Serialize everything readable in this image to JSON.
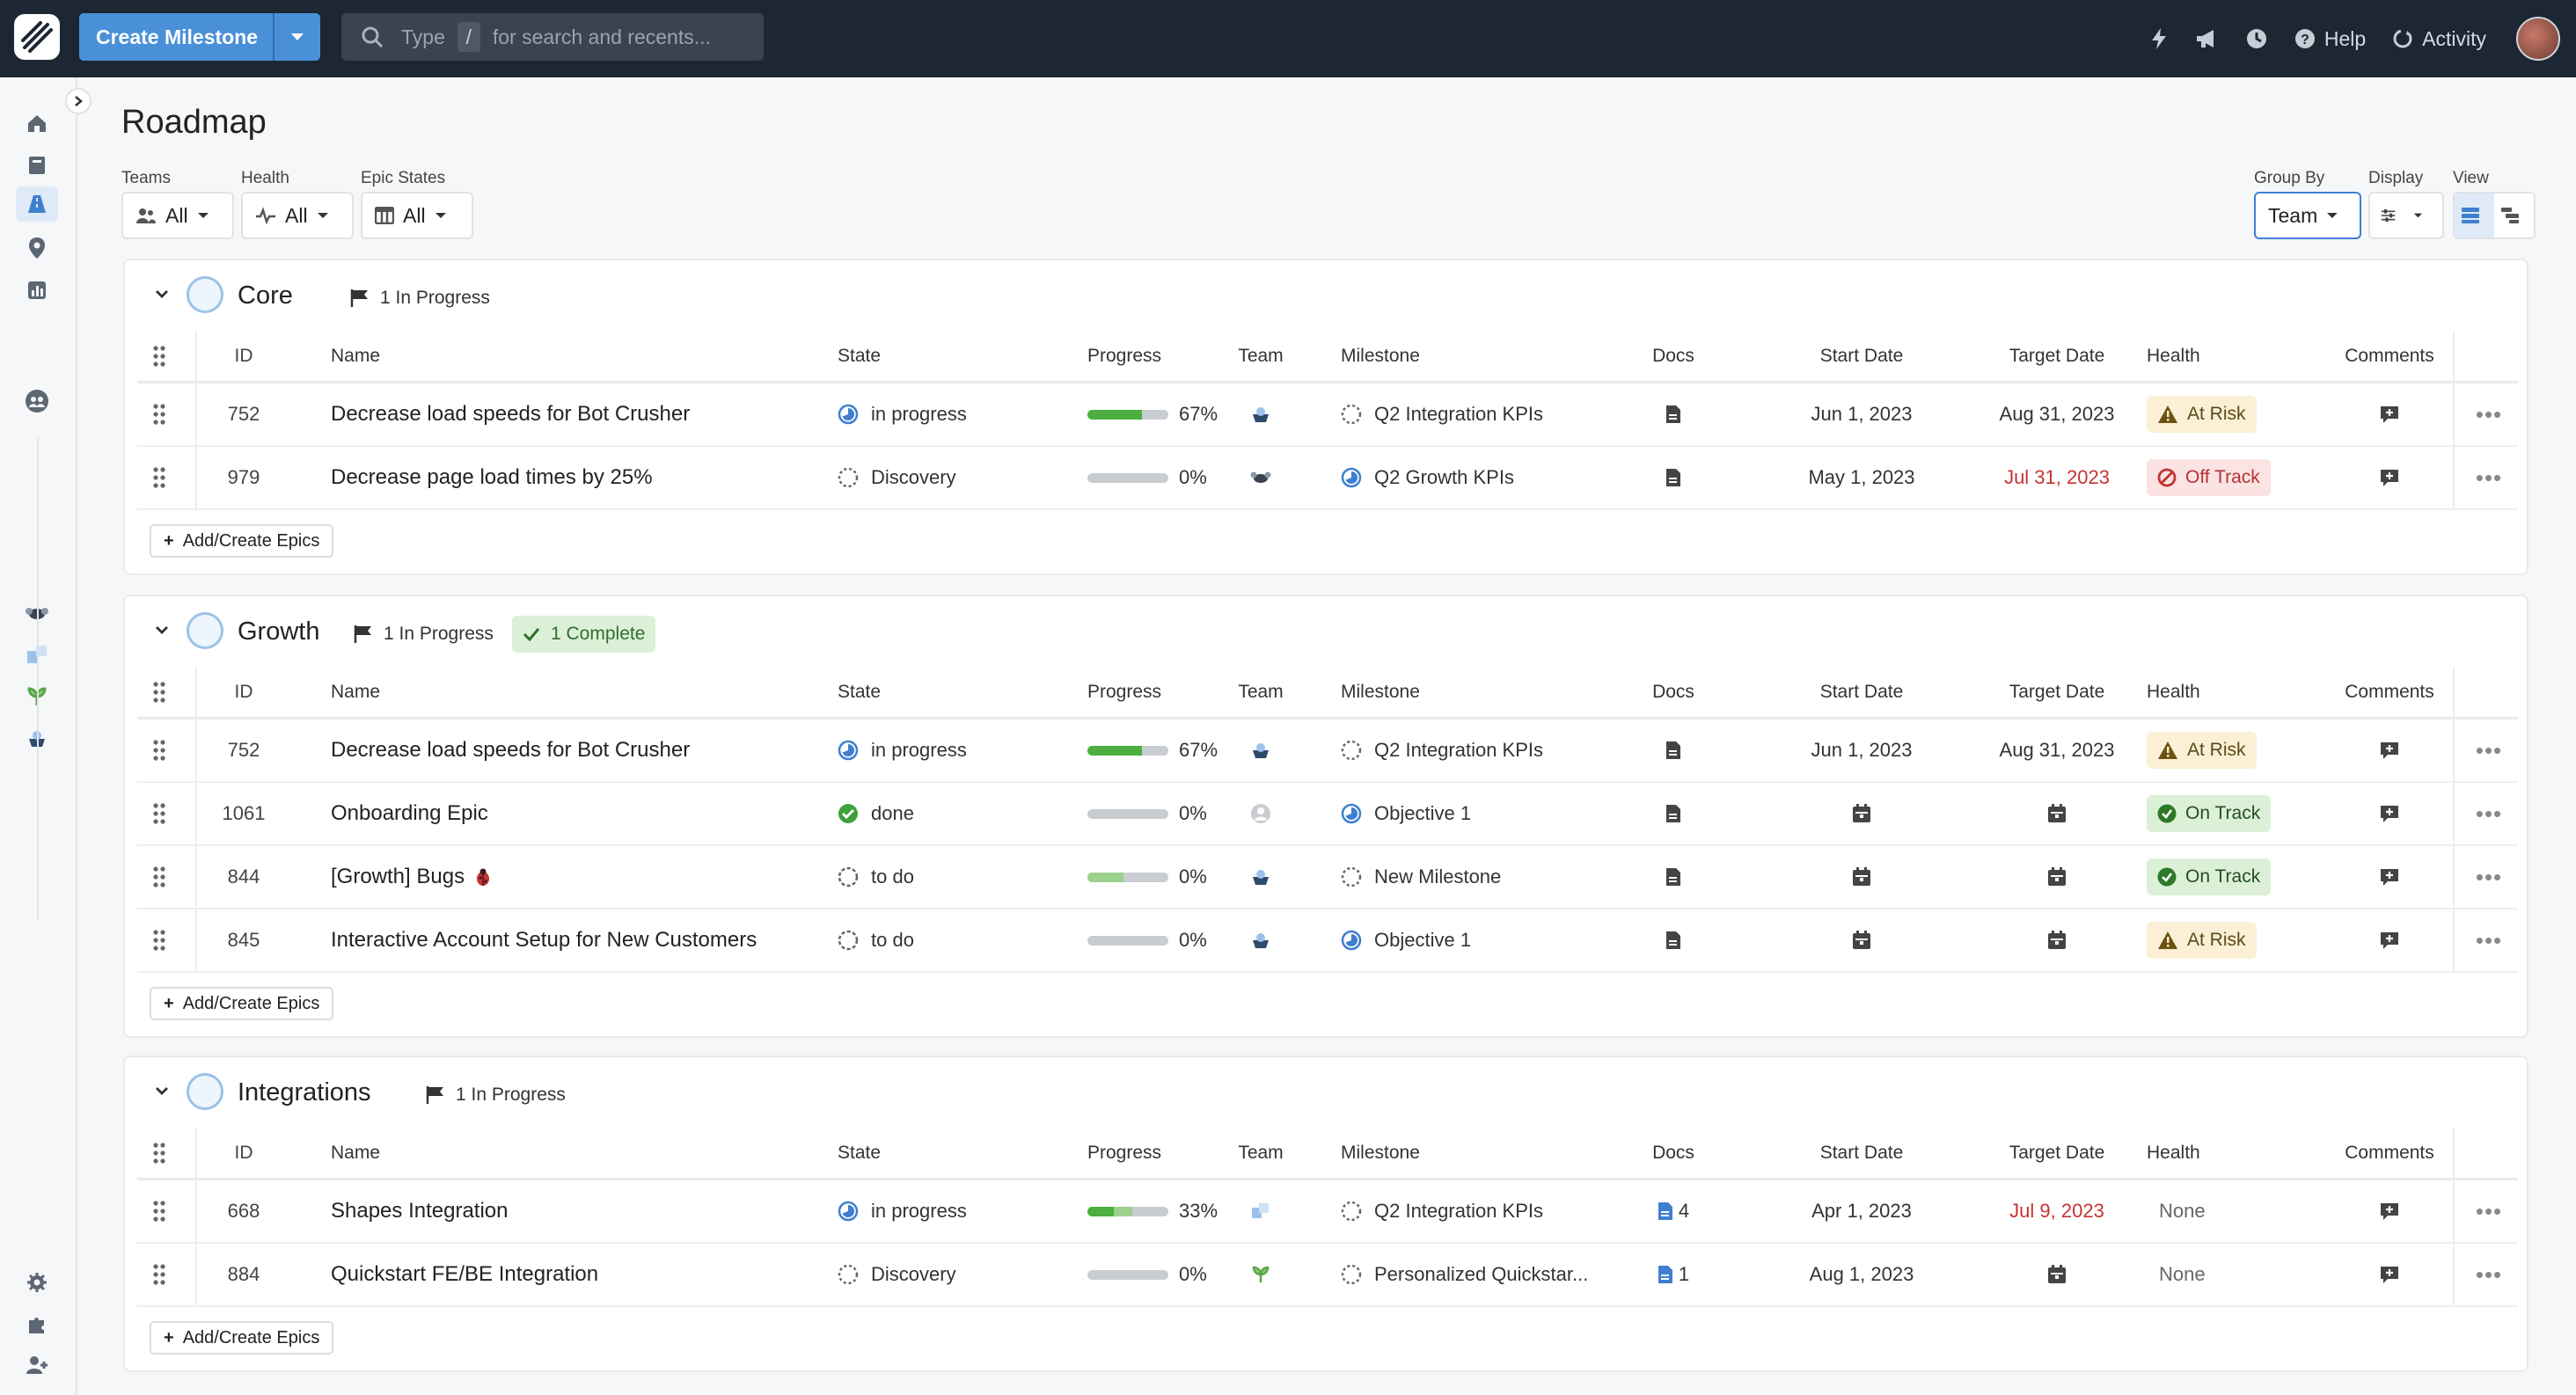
{
  "topbar": {
    "create_label": "Create Milestone",
    "search_type": "Type",
    "search_key": "/",
    "search_rest": "for search and recents...",
    "help": "Help",
    "activity": "Activity"
  },
  "page": {
    "title": "Roadmap",
    "filters": {
      "teams_label": "Teams",
      "teams_value": "All",
      "health_label": "Health",
      "health_value": "All",
      "epic_label": "Epic States",
      "epic_value": "All",
      "group_label": "Group By",
      "group_value": "Team",
      "display_label": "Display",
      "view_label": "View"
    }
  },
  "columns": {
    "id": "ID",
    "name": "Name",
    "state": "State",
    "progress": "Progress",
    "team": "Team",
    "milestone": "Milestone",
    "docs": "Docs",
    "start": "Start Date",
    "target": "Target Date",
    "health": "Health",
    "comments": "Comments"
  },
  "add_label": "Add/Create Epics",
  "groups": [
    {
      "name": "Core",
      "badge_inprogress": "1 In Progress",
      "rows": [
        {
          "id": "752",
          "name": "Decrease load speeds for Bot Crusher",
          "state": "in progress",
          "progress": 67,
          "progress_label": "67%",
          "milestone": "Q2 Integration KPIs",
          "start": "Jun 1, 2023",
          "target": "Aug 31, 2023",
          "health": "At Risk"
        },
        {
          "id": "979",
          "name": "Decrease page load times by 25%",
          "state": "Discovery",
          "progress": 0,
          "progress_label": "0%",
          "milestone": "Q2 Growth KPIs",
          "start": "May 1, 2023",
          "target": "Jul 31, 2023",
          "health": "Off Track"
        }
      ]
    },
    {
      "name": "Growth",
      "badge_inprogress": "1 In Progress",
      "badge_complete": "1 Complete",
      "rows": [
        {
          "id": "752",
          "name": "Decrease load speeds for Bot Crusher",
          "state": "in progress",
          "progress": 67,
          "progress_label": "67%",
          "milestone": "Q2 Integration KPIs",
          "start": "Jun 1, 2023",
          "target": "Aug 31, 2023",
          "health": "At Risk"
        },
        {
          "id": "1061",
          "name": "Onboarding Epic",
          "state": "done",
          "progress": 0,
          "progress_label": "0%",
          "milestone": "Objective 1",
          "health": "On Track"
        },
        {
          "id": "844",
          "name": "[Growth] Bugs",
          "state": "to do",
          "progress": 0,
          "progress_label": "0%",
          "milestone": "New Milestone",
          "health": "On Track"
        },
        {
          "id": "845",
          "name": "Interactive Account Setup for New Customers",
          "state": "to do",
          "progress": 0,
          "progress_label": "0%",
          "milestone": "Objective 1",
          "health": "At Risk"
        }
      ]
    },
    {
      "name": "Integrations",
      "badge_inprogress": "1 In Progress",
      "rows": [
        {
          "id": "668",
          "name": "Shapes Integration",
          "state": "in progress",
          "progress": 33,
          "progress_label": "33%",
          "milestone": "Q2 Integration KPIs",
          "docs": "4",
          "start": "Apr 1, 2023",
          "target": "Jul 9, 2023",
          "health": "None"
        },
        {
          "id": "884",
          "name": "Quickstart FE/BE Integration",
          "state": "Discovery",
          "progress": 0,
          "progress_label": "0%",
          "milestone": "Personalized Quickstar...",
          "docs": "1",
          "start": "Aug 1, 2023",
          "health": "None"
        }
      ]
    }
  ]
}
